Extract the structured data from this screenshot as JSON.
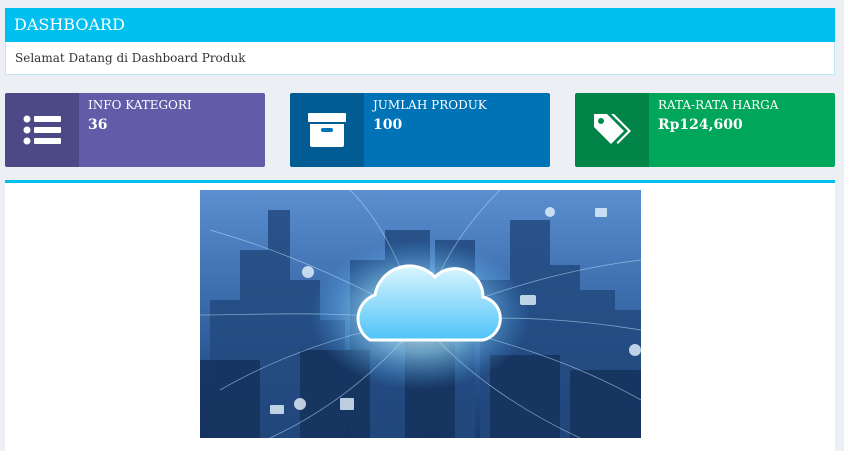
{
  "header": {
    "title": "DASHBOARD",
    "welcome": "Selamat Datang di Dashboard Produk"
  },
  "info_boxes": [
    {
      "label": "INFO KATEGORI",
      "value": "36",
      "icon": "list-icon",
      "color": "#605ca8"
    },
    {
      "label": "JUMLAH PRODUK",
      "value": "100",
      "icon": "archive-icon",
      "color": "#0073b7"
    },
    {
      "label": "RATA-RATA HARGA",
      "value": "Rp124,600",
      "icon": "tags-icon",
      "color": "#00a65a"
    }
  ],
  "hero_image": {
    "subject": "cloud-computing-city-image",
    "accent": "#00c0ef"
  }
}
